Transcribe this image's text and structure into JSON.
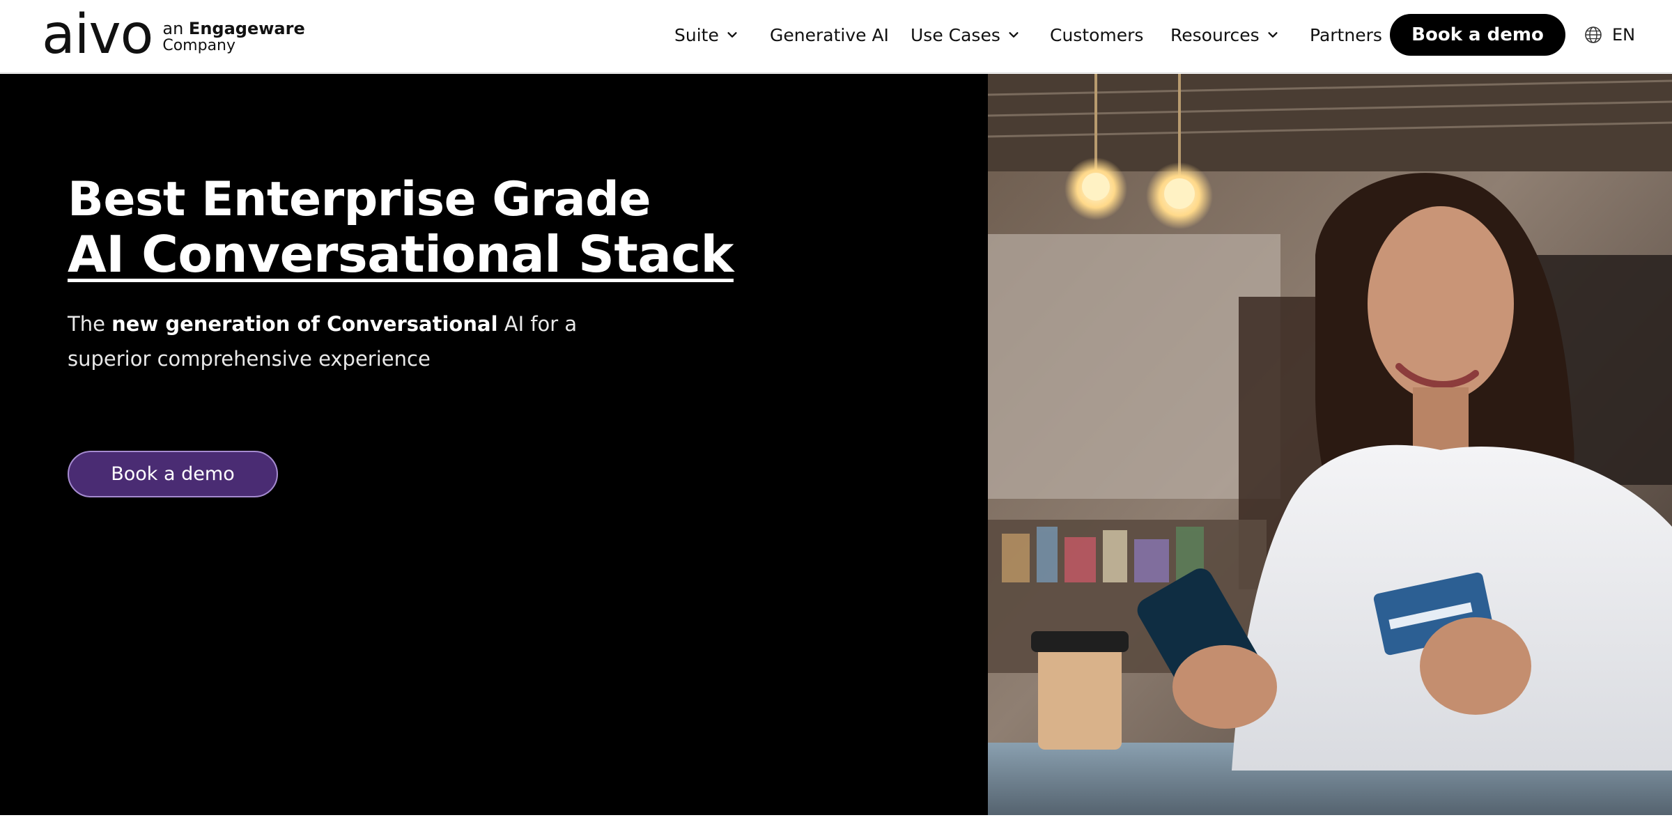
{
  "brand": {
    "logo_text": "aivo",
    "tagline_prefix": "an",
    "tagline_brand": "Engageware",
    "tagline_suffix": "Company"
  },
  "nav": {
    "items": [
      {
        "label": "Suite",
        "has_dropdown": true
      },
      {
        "label": "Generative AI",
        "has_dropdown": false
      },
      {
        "label": "Use Cases",
        "has_dropdown": true
      },
      {
        "label": "Customers",
        "has_dropdown": false
      },
      {
        "label": "Resources",
        "has_dropdown": true
      },
      {
        "label": "Partners",
        "has_dropdown": false
      }
    ],
    "cta_label": "Book a demo",
    "language": "EN"
  },
  "hero": {
    "title_line1": "Best Enterprise Grade",
    "title_line2": "AI Conversational Stack",
    "subtitle_part1": "The",
    "subtitle_bold": "new generation of Conversational",
    "subtitle_part2": "AI for a superior comprehensive experience",
    "cta_label": "Book a demo"
  },
  "colors": {
    "hero_bg": "#000000",
    "cta_fill": "#4a2c73",
    "cta_border": "#a58bd0",
    "nav_button": "#000000"
  }
}
